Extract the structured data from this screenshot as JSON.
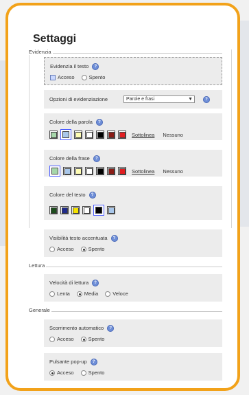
{
  "title": "Settaggi",
  "sections": {
    "evidenzia": {
      "label": "Evidenzia"
    },
    "lettura": {
      "label": "Lettura"
    },
    "generale": {
      "label": "Generale"
    }
  },
  "evidenzia_testo": {
    "label": "Evidenzia il testo",
    "acceso": "Acceso",
    "spento": "Spento"
  },
  "opzioni_evidenziazione": {
    "label": "Opzioni di evidenziazione",
    "selected": "Parole e frasi"
  },
  "colore_parola": {
    "label": "Colore della parola",
    "colors": [
      "#a6d7aa",
      "#a9c7ea",
      "#fffdb4",
      "#ffffff",
      "#000000",
      "#8a1c16",
      "#e11e21"
    ],
    "underline": "Sottolinea",
    "none": "Nessuno"
  },
  "colore_frase": {
    "label": "Colore della frase",
    "colors": [
      "#a6d7aa",
      "#a9c7ea",
      "#fffdb4",
      "#ffffff",
      "#000000",
      "#8a1c16",
      "#e11e21"
    ],
    "underline": "Sottolinea",
    "none": "Nessuno"
  },
  "colore_testo": {
    "label": "Colore del testo",
    "colors": [
      "#1e4d1e",
      "#1f2a8a",
      "#f4e200",
      "#ffffff",
      "#000000",
      "#a9c7ea"
    ]
  },
  "visibilita": {
    "label": "Visibilità testo accentuata",
    "acceso": "Acceso",
    "spento": "Spento"
  },
  "velocita": {
    "label": "Velocità di lettura",
    "lenta": "Lenta",
    "media": "Media",
    "veloce": "Veloce"
  },
  "scorrimento": {
    "label": "Scorrimento automatico",
    "acceso": "Acceso",
    "spento": "Spento"
  },
  "popup": {
    "label": "Pulsante pop-up",
    "acceso": "Acceso",
    "spento": "Spento"
  },
  "colors": {
    "frame": "#f2a21a",
    "panel": "#ececec",
    "help": "#6f8fd8"
  },
  "icons": {
    "help": "help-icon"
  }
}
